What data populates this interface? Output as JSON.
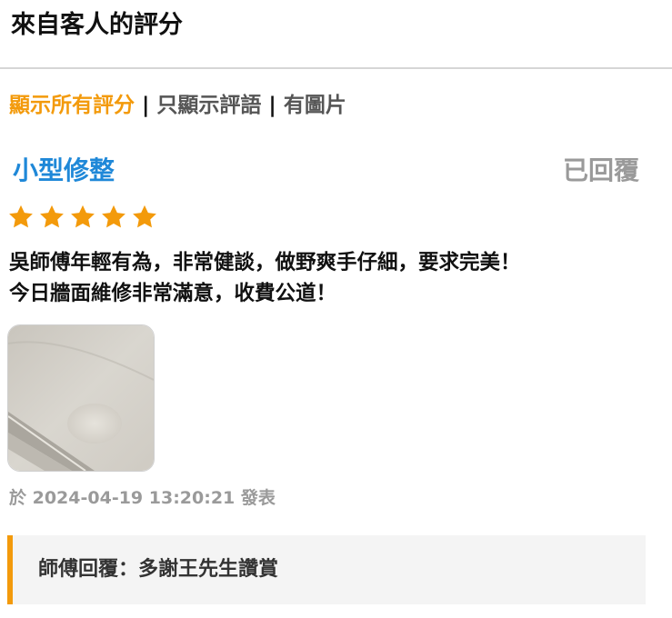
{
  "header": {
    "title": "來自客人的評分"
  },
  "filters": {
    "items": [
      {
        "label": "顯示所有評分",
        "active": true
      },
      {
        "label": "只顯示評語",
        "active": false
      },
      {
        "label": "有圖片",
        "active": false
      }
    ],
    "separator": "|"
  },
  "review": {
    "title": "小型修整",
    "status": "已回覆",
    "rating": 5,
    "rating_max": 5,
    "text_lines": [
      "吳師傅年輕有為，非常健談，做野爽手仔細，要求完美！",
      "今日牆面維修非常滿意，收費公道！"
    ],
    "photo_icon": "wall-photo",
    "timestamp": "於 2024-04-19 13:20:21 發表"
  },
  "reply": {
    "text": "師傅回覆：多謝王先生讚賞"
  },
  "colors": {
    "accent": "#f39a0b",
    "title_blue": "#1f88d8",
    "muted": "#9a9a9a",
    "star": "#f39a0b",
    "reply_bg": "#f4f4f4"
  }
}
